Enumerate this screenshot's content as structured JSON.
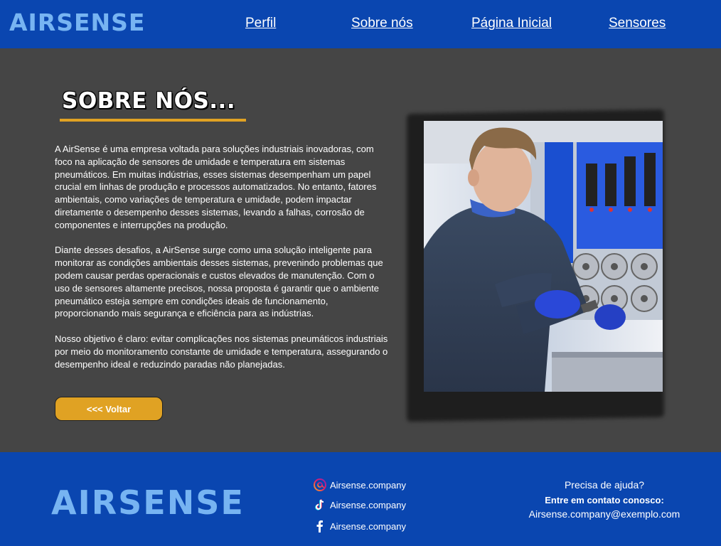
{
  "header": {
    "logo": "AIRSENSE",
    "nav": [
      "Perfil",
      "Sobre nós",
      "Página Inicial",
      "Sensores"
    ]
  },
  "main": {
    "title": "SOBRE NÓS...",
    "paragraphs": [
      "A AirSense é uma empresa voltada para soluções industriais inovadoras, com foco na aplicação de sensores de umidade e temperatura em sistemas pneumáticos. Em muitas indústrias, esses sistemas desempenham um papel crucial em linhas de produção e processos automatizados. No entanto, fatores ambientais, como variações de temperatura e umidade, podem impactar diretamente o desempenho desses sistemas, levando a falhas, corrosão de componentes e interrupções na produção.",
      "Diante desses desafios, a AirSense surge como uma solução inteligente para monitorar as condições ambientais desses sistemas, prevenindo problemas que podem causar perdas operacionais e custos elevados de manutenção. Com o uso de sensores altamente precisos, nossa proposta é garantir que o ambiente pneumático esteja sempre em condições ideais de funcionamento, proporcionando mais segurança e eficiência para as indústrias.",
      "Nosso objetivo é claro: evitar complicações nos sistemas pneumáticos industriais por meio do monitoramento constante de umidade e temperatura, assegurando o desempenho ideal e reduzindo paradas não planejadas."
    ],
    "back_button": "<<< Voltar"
  },
  "footer": {
    "logo": "AIRSENSE",
    "social": [
      {
        "icon": "threads-icon",
        "label": "Airsense.company"
      },
      {
        "icon": "tiktok-icon",
        "label": "Airsense.company"
      },
      {
        "icon": "facebook-icon",
        "label": "Airsense.company"
      }
    ],
    "help_title": "Precisa de ajuda?",
    "contact_label": "Entre em contato conosco:",
    "email": "Airsense.company@exemplo.com"
  },
  "colors": {
    "header_bg": "#0a46b0",
    "body_bg": "#454545",
    "accent": "#e0a223",
    "logo": "#77b4f2"
  }
}
